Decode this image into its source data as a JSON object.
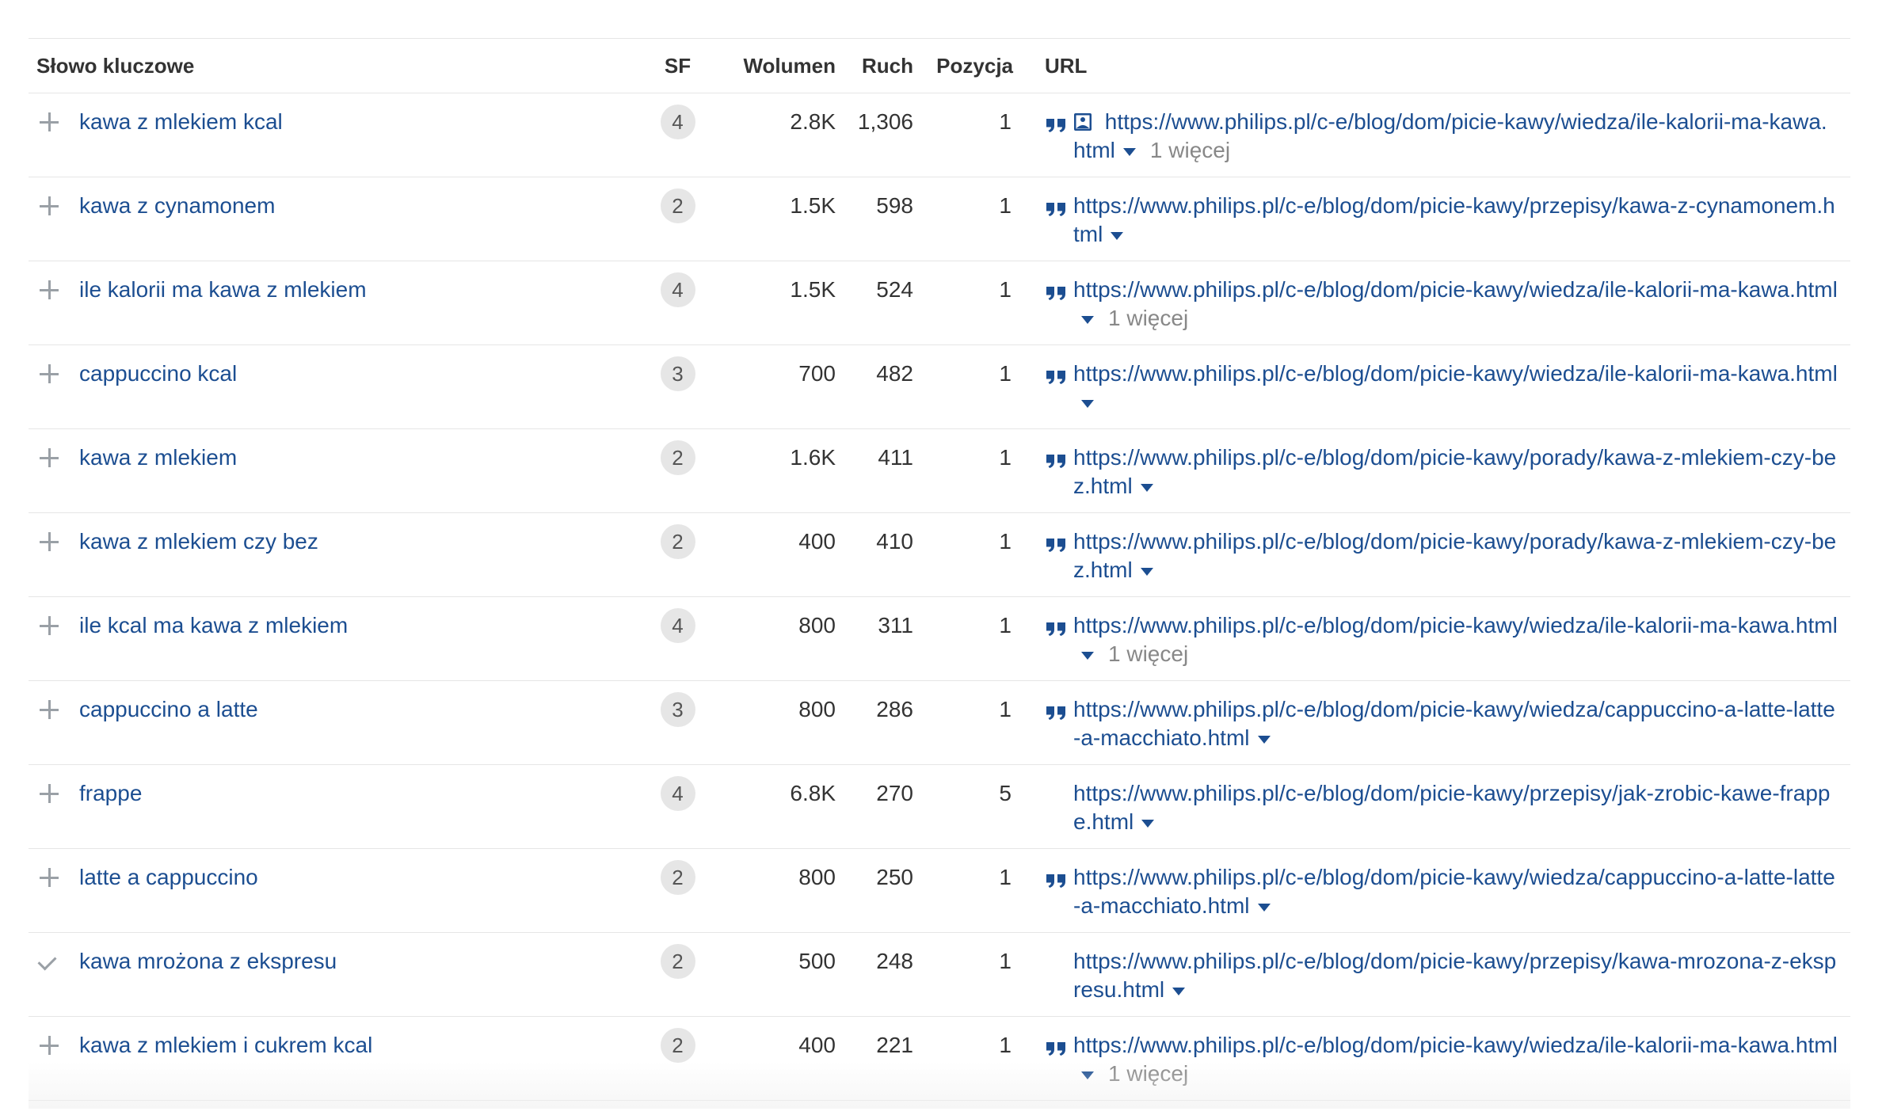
{
  "columns": {
    "keyword": "Słowo kluczowe",
    "sf": "SF",
    "volume": "Wolumen",
    "traffic": "Ruch",
    "position": "Pozycja",
    "url": "URL"
  },
  "icons": {
    "add": "plus-icon",
    "added": "check-icon",
    "snippet": "quote-icon",
    "image": "image-icon",
    "dropdown": "caret-down-icon"
  },
  "colors": {
    "link": "#1c4e91",
    "badge_bg": "#e6e6e6",
    "muted": "#888888"
  },
  "rows": [
    {
      "keyword": "kawa z mlekiem kcal",
      "sf": "4",
      "volume": "2.8K",
      "traffic": "1,306",
      "position": "1",
      "url": "https://www.philips.pl/c-e/blog/dom/picie-kawy/wiedza/ile-kalorii-ma-kawa.html",
      "more": "1 więcej",
      "snippet": true,
      "image": true,
      "action": "add"
    },
    {
      "keyword": "kawa z cynamonem",
      "sf": "2",
      "volume": "1.5K",
      "traffic": "598",
      "position": "1",
      "url": "https://www.philips.pl/c-e/blog/dom/picie-kawy/przepisy/kawa-z-cynamonem.html",
      "more": "",
      "snippet": true,
      "image": false,
      "action": "add"
    },
    {
      "keyword": "ile kalorii ma kawa z mlekiem",
      "sf": "4",
      "volume": "1.5K",
      "traffic": "524",
      "position": "1",
      "url": "https://www.philips.pl/c-e/blog/dom/picie-kawy/wiedza/ile-kalorii-ma-kawa.html",
      "more": "1 więcej",
      "snippet": true,
      "image": false,
      "action": "add"
    },
    {
      "keyword": "cappuccino kcal",
      "sf": "3",
      "volume": "700",
      "traffic": "482",
      "position": "1",
      "url": "https://www.philips.pl/c-e/blog/dom/picie-kawy/wiedza/ile-kalorii-ma-kawa.html",
      "more": "",
      "snippet": true,
      "image": false,
      "action": "add"
    },
    {
      "keyword": "kawa z mlekiem",
      "sf": "2",
      "volume": "1.6K",
      "traffic": "411",
      "position": "1",
      "url": "https://www.philips.pl/c-e/blog/dom/picie-kawy/porady/kawa-z-mlekiem-czy-bez.html",
      "more": "",
      "snippet": true,
      "image": false,
      "action": "add"
    },
    {
      "keyword": "kawa z mlekiem czy bez",
      "sf": "2",
      "volume": "400",
      "traffic": "410",
      "position": "1",
      "url": "https://www.philips.pl/c-e/blog/dom/picie-kawy/porady/kawa-z-mlekiem-czy-bez.html",
      "more": "",
      "snippet": true,
      "image": false,
      "action": "add"
    },
    {
      "keyword": "ile kcal ma kawa z mlekiem",
      "sf": "4",
      "volume": "800",
      "traffic": "311",
      "position": "1",
      "url": "https://www.philips.pl/c-e/blog/dom/picie-kawy/wiedza/ile-kalorii-ma-kawa.html",
      "more": "1 więcej",
      "snippet": true,
      "image": false,
      "action": "add"
    },
    {
      "keyword": "cappuccino a latte",
      "sf": "3",
      "volume": "800",
      "traffic": "286",
      "position": "1",
      "url": "https://www.philips.pl/c-e/blog/dom/picie-kawy/wiedza/cappuccino-a-latte-latte-a-macchiato.html",
      "more": "",
      "snippet": true,
      "image": false,
      "action": "add"
    },
    {
      "keyword": "frappe",
      "sf": "4",
      "volume": "6.8K",
      "traffic": "270",
      "position": "5",
      "url": "https://www.philips.pl/c-e/blog/dom/picie-kawy/przepisy/jak-zrobic-kawe-frappe.html",
      "more": "",
      "snippet": false,
      "image": false,
      "action": "add"
    },
    {
      "keyword": "latte a cappuccino",
      "sf": "2",
      "volume": "800",
      "traffic": "250",
      "position": "1",
      "url": "https://www.philips.pl/c-e/blog/dom/picie-kawy/wiedza/cappuccino-a-latte-latte-a-macchiato.html",
      "more": "",
      "snippet": true,
      "image": false,
      "action": "add"
    },
    {
      "keyword": "kawa mrożona z ekspresu",
      "sf": "2",
      "volume": "500",
      "traffic": "248",
      "position": "1",
      "url": "https://www.philips.pl/c-e/blog/dom/picie-kawy/przepisy/kawa-mrozona-z-ekspresu.html",
      "more": "",
      "snippet": false,
      "image": false,
      "action": "added"
    },
    {
      "keyword": "kawa z mlekiem i cukrem kcal",
      "sf": "2",
      "volume": "400",
      "traffic": "221",
      "position": "1",
      "url": "https://www.philips.pl/c-e/blog/dom/picie-kawy/wiedza/ile-kalorii-ma-kawa.html",
      "more": "1 więcej",
      "snippet": true,
      "image": false,
      "action": "add"
    }
  ]
}
